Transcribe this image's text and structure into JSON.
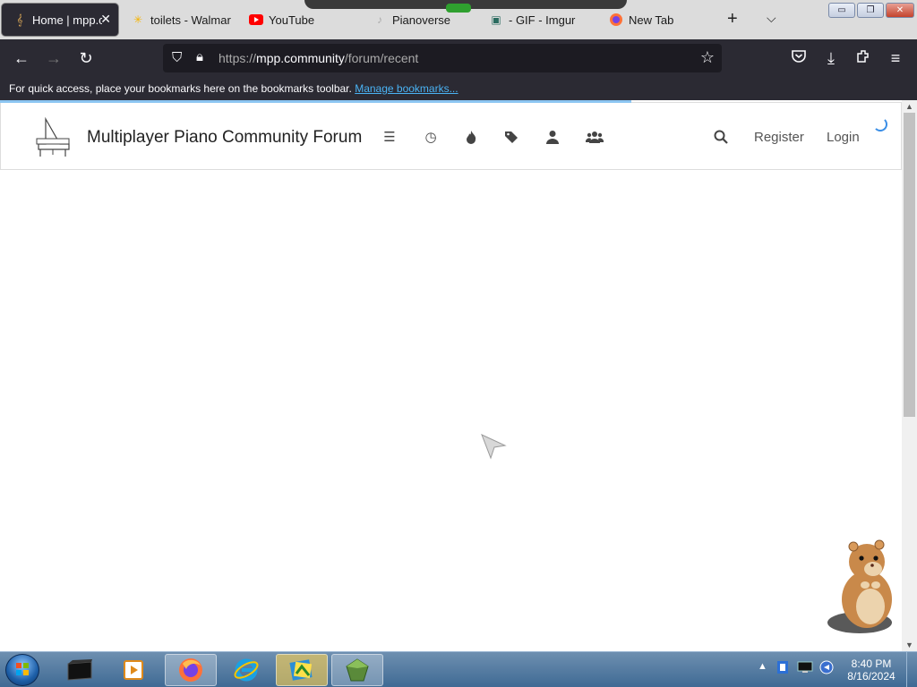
{
  "browser": {
    "tabs": [
      {
        "title": "Home | mpp.c",
        "icon": "piano-favicon",
        "active": true
      },
      {
        "title": "toilets - Walmart",
        "icon": "walmart-favicon",
        "active": false
      },
      {
        "title": "YouTube",
        "icon": "youtube-favicon",
        "active": false
      },
      {
        "title": "Pianoverse",
        "icon": "pianoverse-favicon",
        "active": false
      },
      {
        "title": "- GIF - Imgur",
        "icon": "imgur-favicon",
        "active": false
      },
      {
        "title": "New Tab",
        "icon": "firefox-favicon",
        "active": false
      }
    ],
    "new_tab_icon": "+",
    "list_tabs_icon": "chevron-down-icon",
    "url": {
      "prefix": "https://",
      "host": "mpp.community",
      "path": "/forum/recent"
    },
    "bookmarks_bar": {
      "message": "For quick access, place your bookmarks here on the bookmarks toolbar.",
      "link": "Manage bookmarks..."
    }
  },
  "site": {
    "title": "Multiplayer Piano Community Forum",
    "nav_icons": [
      "categories-icon",
      "recent-icon",
      "popular-icon",
      "tags-icon",
      "user-icon",
      "groups-icon"
    ],
    "register": "Register",
    "login": "Login"
  },
  "taskbar": {
    "time": "8:40 PM",
    "date": "8/16/2024",
    "items": [
      "folder-black-icon",
      "media-player-icon",
      "firefox-icon",
      "internet-explorer-icon",
      "sticky-app-icon",
      "green-gem-icon"
    ]
  },
  "colors": {
    "tab_active_bg": "#2b2a33",
    "toolbar_bg": "#2b2a33",
    "link_blue": "#4ab3f4",
    "load_bar": "#8cc6f2"
  }
}
